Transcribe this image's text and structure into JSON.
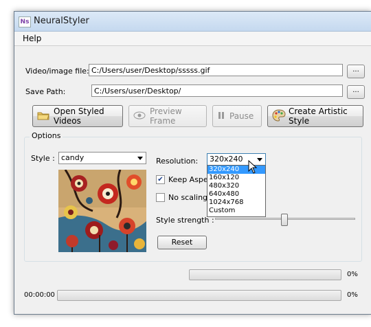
{
  "window": {
    "title": "NeuralStyler",
    "icon_text": "Ns"
  },
  "menu": {
    "items": [
      "Help"
    ]
  },
  "inputs": {
    "video_label": "Video/image file:",
    "video_value": "C:/Users/user/Desktop/sssss.gif",
    "save_label": "Save Path:",
    "save_value": "C:/Users/user/Desktop/",
    "browse_label": "..."
  },
  "toolbar": {
    "open_label": "Open Styled Videos",
    "preview_label": "Preview Frame",
    "pause_label": "Pause",
    "create_label": "Create Artistic Style"
  },
  "options": {
    "group_title": "Options",
    "style_label": "Style :",
    "style_value": "candy",
    "resolution_label": "Resolution:",
    "resolution_value": "320x240",
    "resolution_options": [
      "320x240",
      "160x120",
      "480x320",
      "640x480",
      "1024x768",
      "Custom"
    ],
    "keep_aspect_label": "Keep Aspe",
    "keep_aspect_checked": true,
    "no_scaling_label": "No scaling",
    "no_scaling_checked": false,
    "strength_label": "Style strength :",
    "strength_value": 0.55,
    "reset_label": "Reset"
  },
  "progress": {
    "top_percent_label": "0%",
    "top_value": 0,
    "bottom_time": "00:00:00",
    "bottom_percent_label": "0%",
    "bottom_value": 0
  }
}
